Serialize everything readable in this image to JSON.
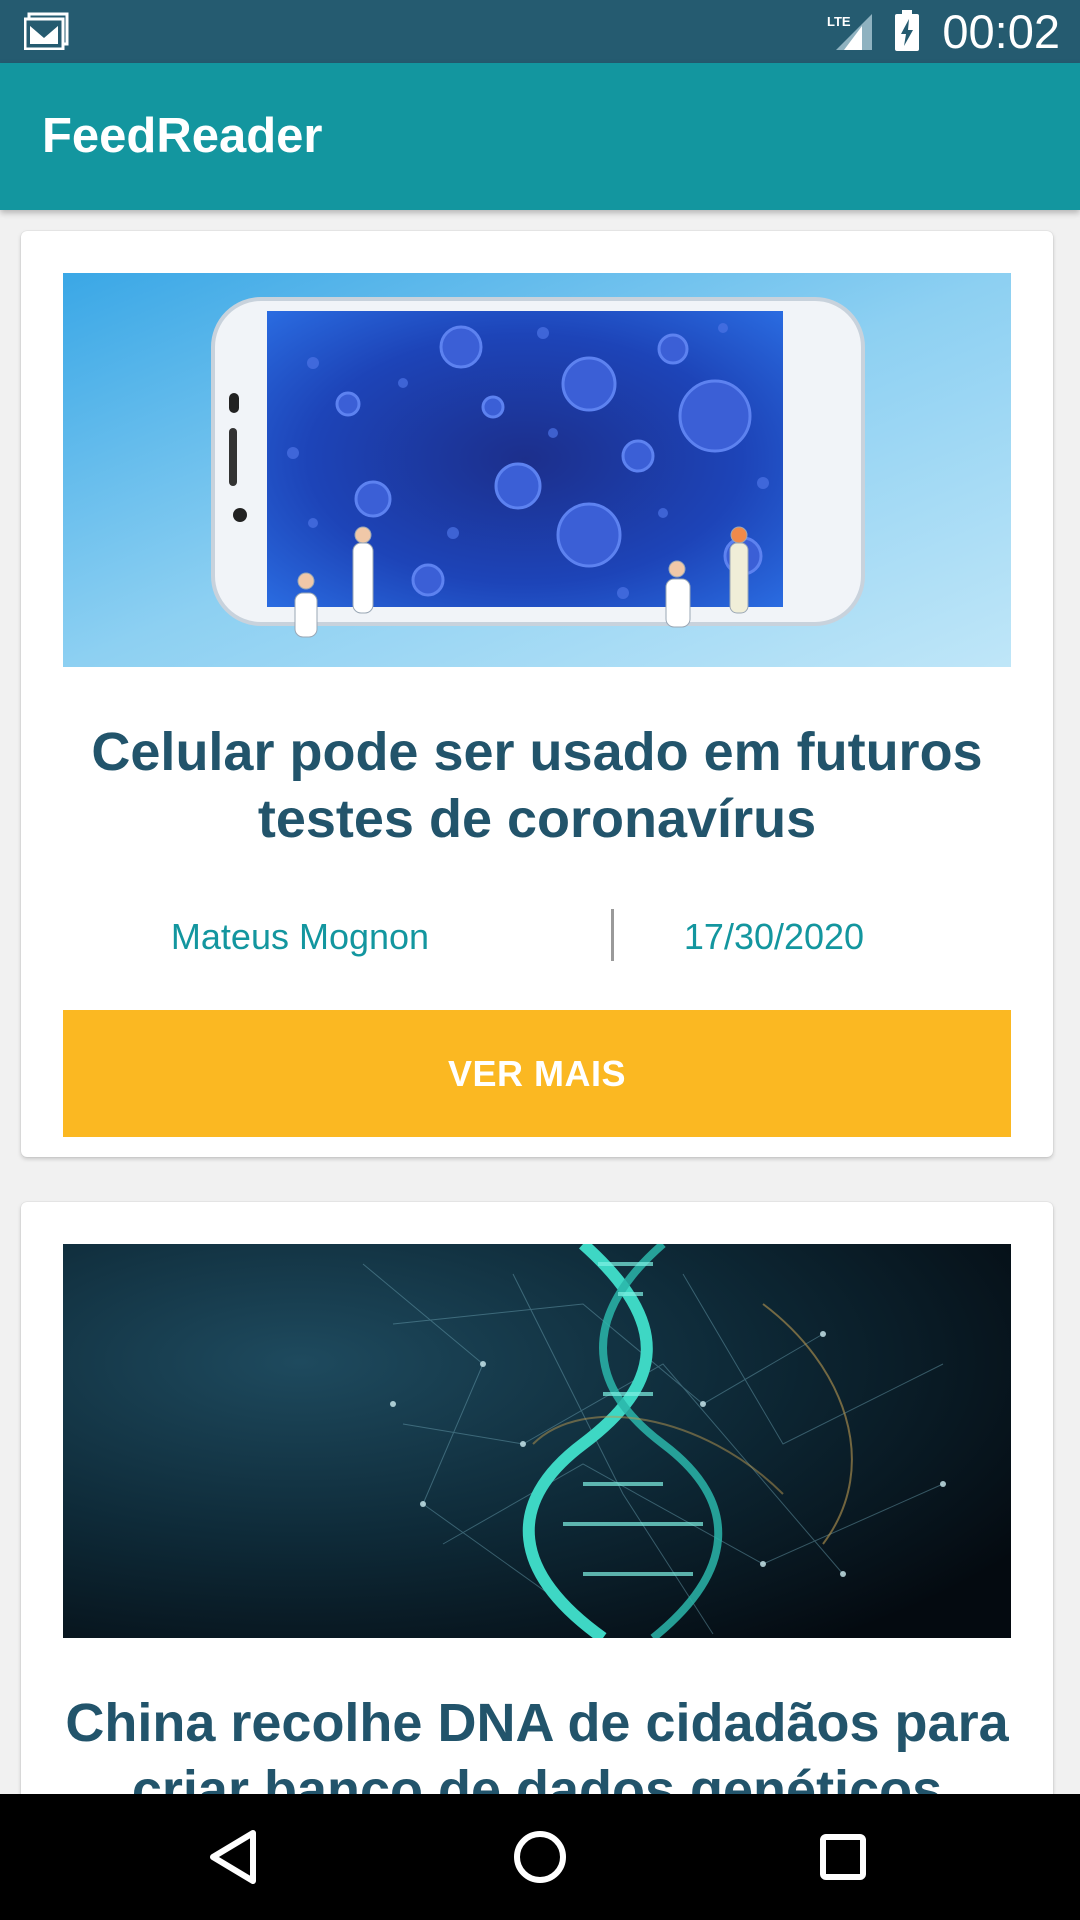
{
  "status_bar": {
    "time": "00:02",
    "network": "LTE",
    "icons": [
      "mail-icon",
      "lte-signal-icon",
      "battery-charging-icon"
    ]
  },
  "app_bar": {
    "title": "FeedReader"
  },
  "feed": {
    "items": [
      {
        "title": "Celular pode ser usado em futuros testes de coronavírus",
        "author": "Mateus Mognon",
        "date": "17/30/2020",
        "button_label": "VER MAIS",
        "image": "phone-with-virus-image"
      },
      {
        "title": "China recolhe DNA de cidadãos para criar banco de dados genéticos",
        "image": "dna-helix-image"
      }
    ]
  },
  "nav_bar": {
    "icons": [
      "back-icon",
      "home-icon",
      "recents-icon"
    ]
  },
  "colors": {
    "status_bar": "#255b70",
    "app_bar": "#13969f",
    "title_text": "#22546b",
    "meta_text": "#13969f",
    "button": "#fbb822",
    "background": "#f1f1f1"
  }
}
